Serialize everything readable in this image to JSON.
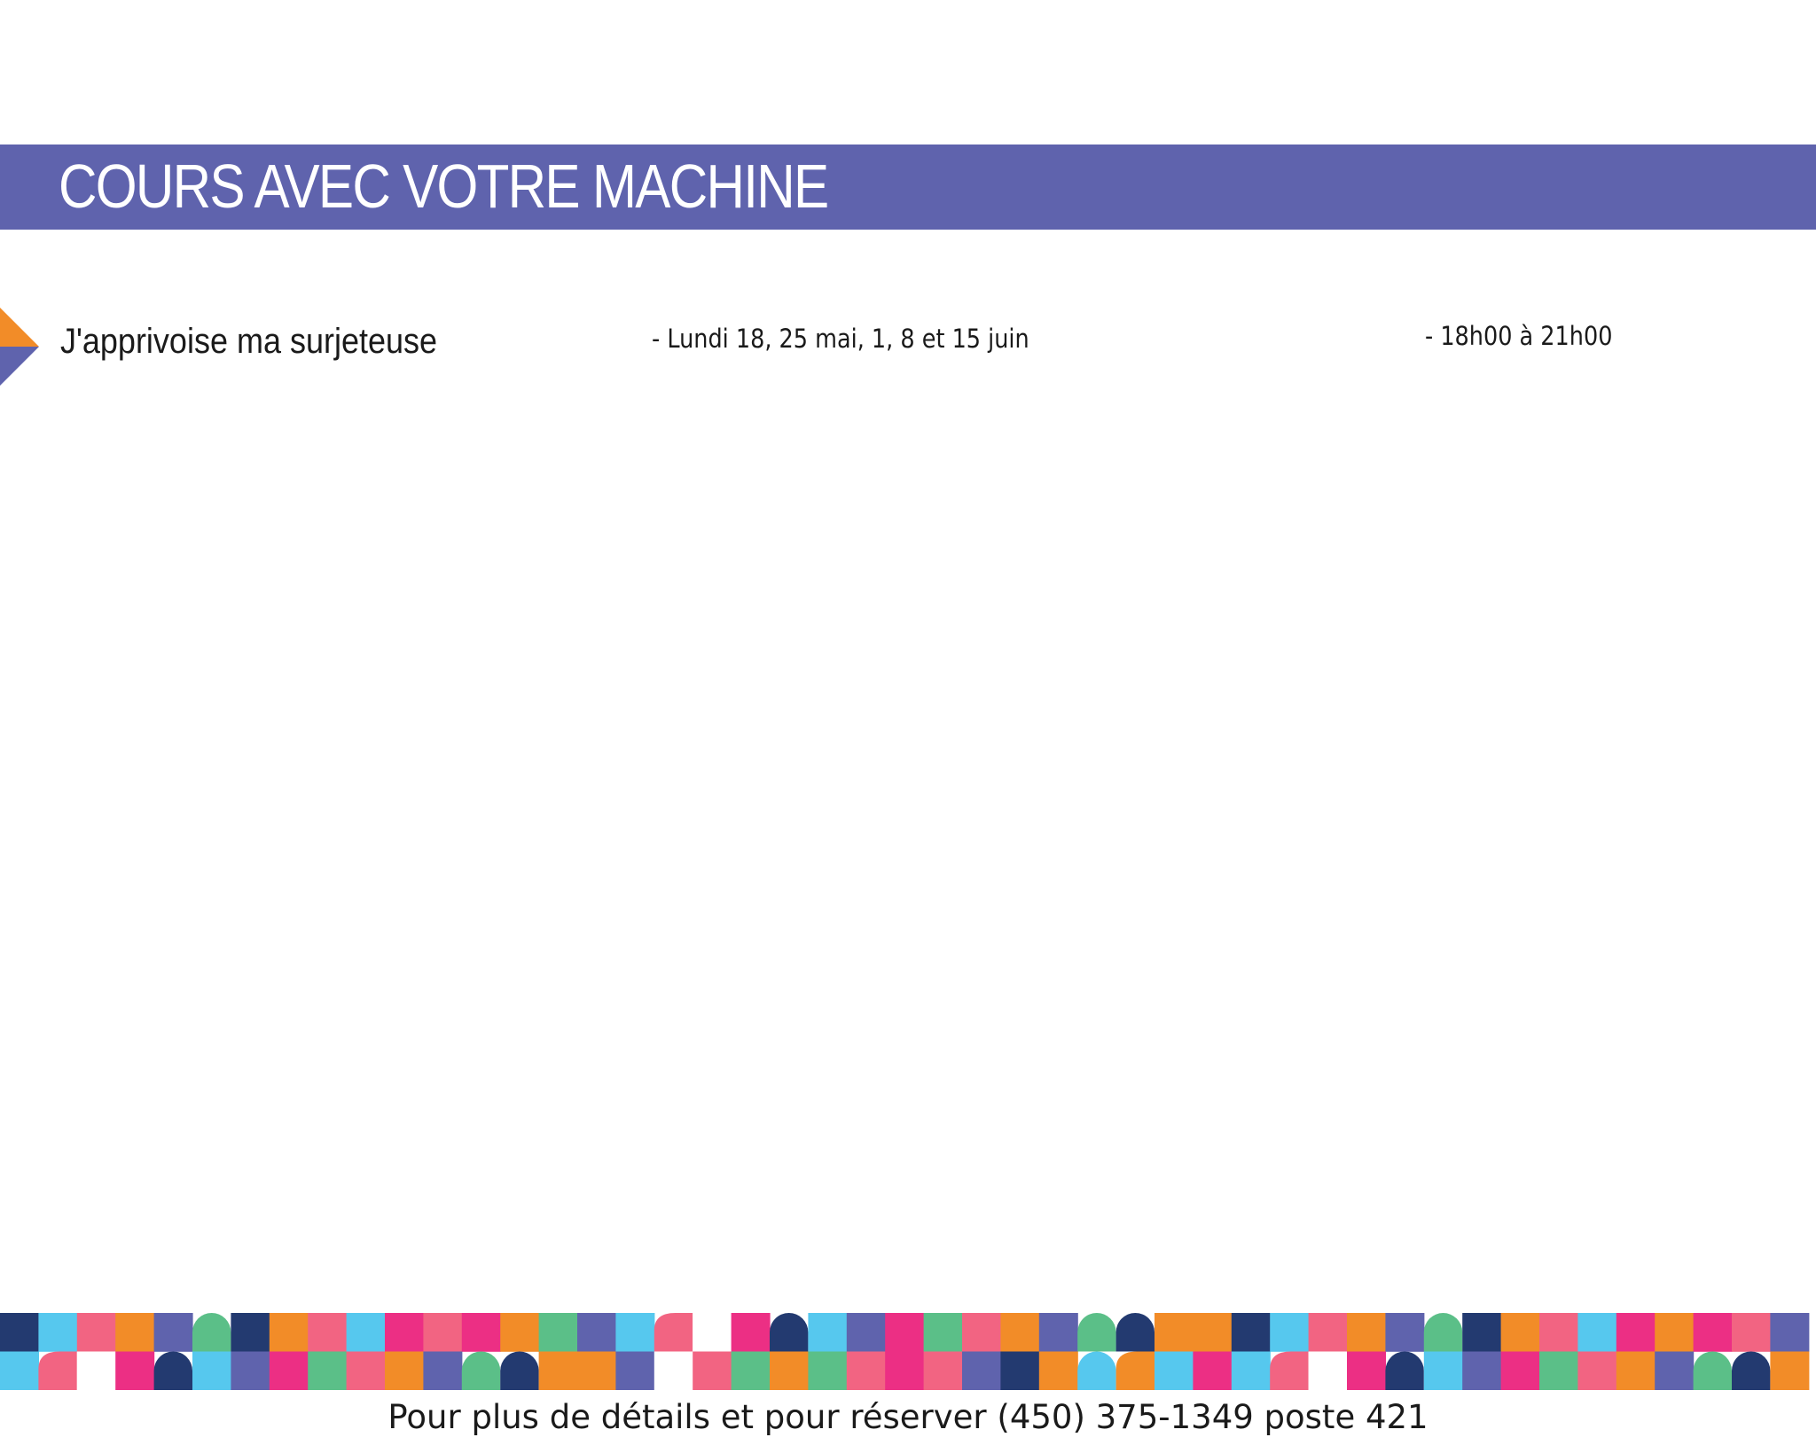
{
  "header": {
    "title": "COURS AVEC VOTRE MACHINE",
    "band_color": "#5f63ad"
  },
  "courses": [
    {
      "name": "J'apprivoise ma surjeteuse",
      "dates": "- Lundi 18, 25 mai, 1, 8 et 15  juin",
      "time": "- 18h00 à 21h00",
      "marker_colors": [
        "#f28c28",
        "#5f63ad"
      ]
    }
  ],
  "footer": {
    "contact": "Pour plus de détails et pour réserver (450) 375-1349 poste 421"
  },
  "pattern": {
    "colors": {
      "navy": "#233a70",
      "cyan": "#56c8ee",
      "pink": "#f26482",
      "orange": "#f28c28",
      "purple": "#5f63ad",
      "green": "#5bbf88",
      "magenta": "#ec2f84"
    }
  }
}
